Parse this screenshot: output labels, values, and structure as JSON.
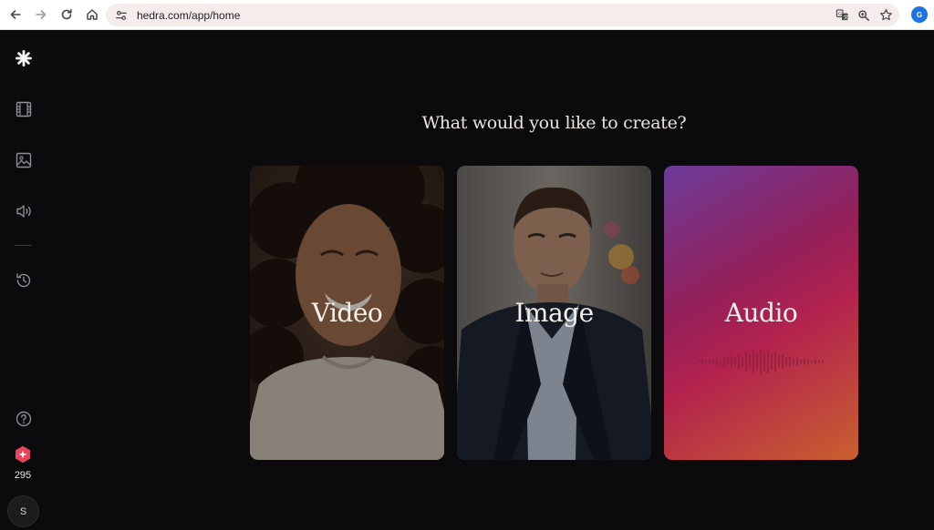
{
  "browser": {
    "url": "hedra.com/app/home",
    "icons": [
      "back-icon",
      "forward-icon",
      "reload-icon",
      "home-icon",
      "site-info-icon",
      "translate-icon",
      "zoom-icon",
      "bookmark-star-icon",
      "profile-icon"
    ]
  },
  "sidebar": {
    "items": [
      {
        "name": "logo",
        "icon": "hedra-logo-icon"
      },
      {
        "name": "video",
        "icon": "film-icon"
      },
      {
        "name": "image",
        "icon": "image-icon"
      },
      {
        "name": "audio",
        "icon": "speaker-icon"
      },
      {
        "name": "history",
        "icon": "history-icon"
      },
      {
        "name": "help",
        "icon": "help-icon"
      }
    ],
    "credits": "295",
    "avatar_initial": "S"
  },
  "main": {
    "heading": "What would you like to create?",
    "cards": [
      {
        "label": "Video"
      },
      {
        "label": "Image"
      },
      {
        "label": "Audio"
      }
    ]
  },
  "colors": {
    "background": "#0b0b0d",
    "accent": "#e8445a",
    "audio_gradient_start": "#6c3b9a",
    "audio_gradient_end": "#c9602e"
  }
}
